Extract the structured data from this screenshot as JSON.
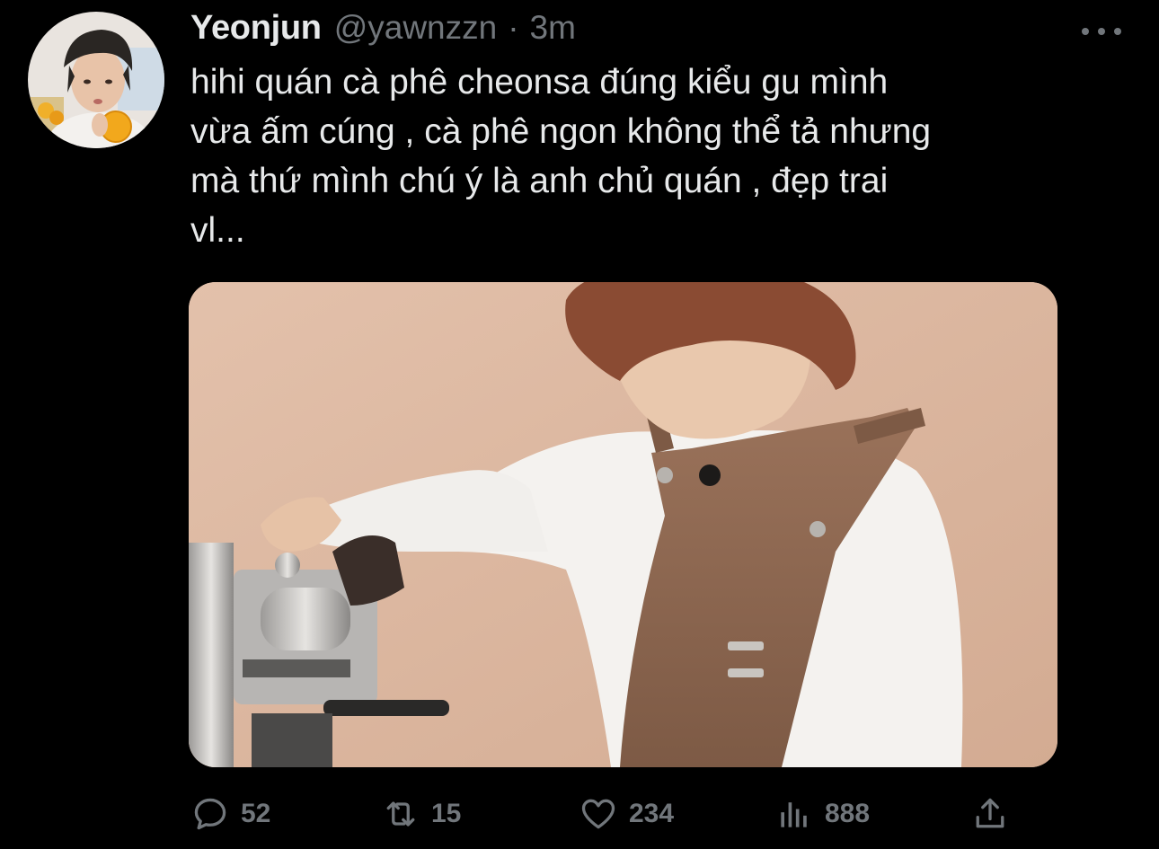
{
  "tweet": {
    "author": {
      "display_name": "Yeonjun",
      "handle": "@yawnzzn",
      "avatar_icon": "profile-photo"
    },
    "separator": "·",
    "time": "3m",
    "more_icon": "ellipsis-icon",
    "text_lines": [
      "hihi quán cà phê cheonsa đúng kiểu gu mình",
      "vừa ấm cúng , cà phê ngon không thể tả nhưng",
      "mà thứ mình chú ý là anh chủ quán , đẹp trai",
      "vl..."
    ],
    "media": {
      "type": "photo",
      "icon": "photo-of-barista-at-espresso-machine"
    },
    "actions": {
      "reply": {
        "icon": "reply-bubble-icon",
        "count": "52"
      },
      "retweet": {
        "icon": "retweet-icon",
        "count": "15"
      },
      "like": {
        "icon": "heart-icon",
        "count": "234"
      },
      "views": {
        "icon": "analytics-bars-icon",
        "count": "888"
      },
      "share": {
        "icon": "share-upload-icon"
      }
    }
  },
  "colors": {
    "background": "#000000",
    "primary_text": "#e7e9ea",
    "secondary_text": "#71767b"
  }
}
